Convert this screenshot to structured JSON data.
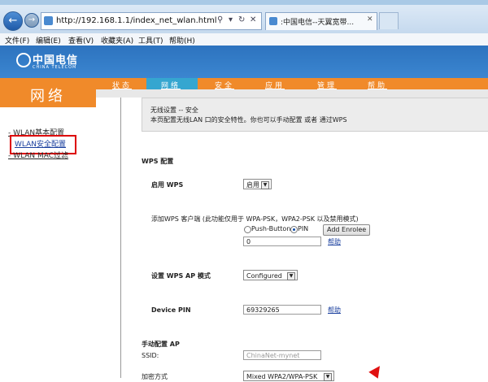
{
  "browser": {
    "url": "http://192.168.1.1/index_net_wlan.html",
    "tab_title": ":中国电信--天翼宽带...",
    "menu": [
      "文件(F)",
      "编辑(E)",
      "查看(V)",
      "收藏夹(A)",
      "工具(T)",
      "帮助(H)"
    ]
  },
  "header": {
    "logo_cn": "中国电信",
    "logo_en": "CHINA TELECOM",
    "section_title": "网络",
    "tabs": [
      "状态",
      "网络",
      "安全",
      "应用",
      "管理",
      "帮助"
    ],
    "active_tab": "网络"
  },
  "sidebar": {
    "items": [
      {
        "label": "- WLAN基本配置"
      },
      {
        "label": "WLAN安全配置"
      },
      {
        "label": "- WLAN MAC过滤"
      }
    ]
  },
  "info": {
    "line1": "无线设置 -- 安全",
    "line2": "本页配置无线LAN 口的安全特性。你也可以手动配置 或者 通过WPS"
  },
  "wps": {
    "section_title": "WPS 配置",
    "enable_label": "启用 WPS",
    "enable_value": "启用",
    "add_client_label": "添加WPS 客户端 (此功能仅用于 WPA-PSK，WPA2-PSK 以及禁用模式)",
    "radio_push": "Push-Button",
    "radio_pin": "PIN",
    "add_enrollee_button": "Add Enrolee",
    "pin_input_value": "0",
    "help_link": "帮助",
    "ap_mode_label": "设置 WPS AP 模式",
    "ap_mode_value": "Configured",
    "device_pin_label": "Device PIN",
    "device_pin_value": "69329265",
    "device_pin_help": "帮助"
  },
  "manual": {
    "section_title": "手动配置 AP",
    "ssid_label": "SSID:",
    "ssid_value": "ChinaNet-mynet",
    "encryption_label": "加密方式",
    "encryption_value": "Mixed WPA2/WPA-PSK"
  },
  "colors": {
    "orange": "#f08a2a",
    "blue_banner": "#2d73bf",
    "active_tab": "#35a6d0",
    "highlight_red": "#dd0000"
  }
}
